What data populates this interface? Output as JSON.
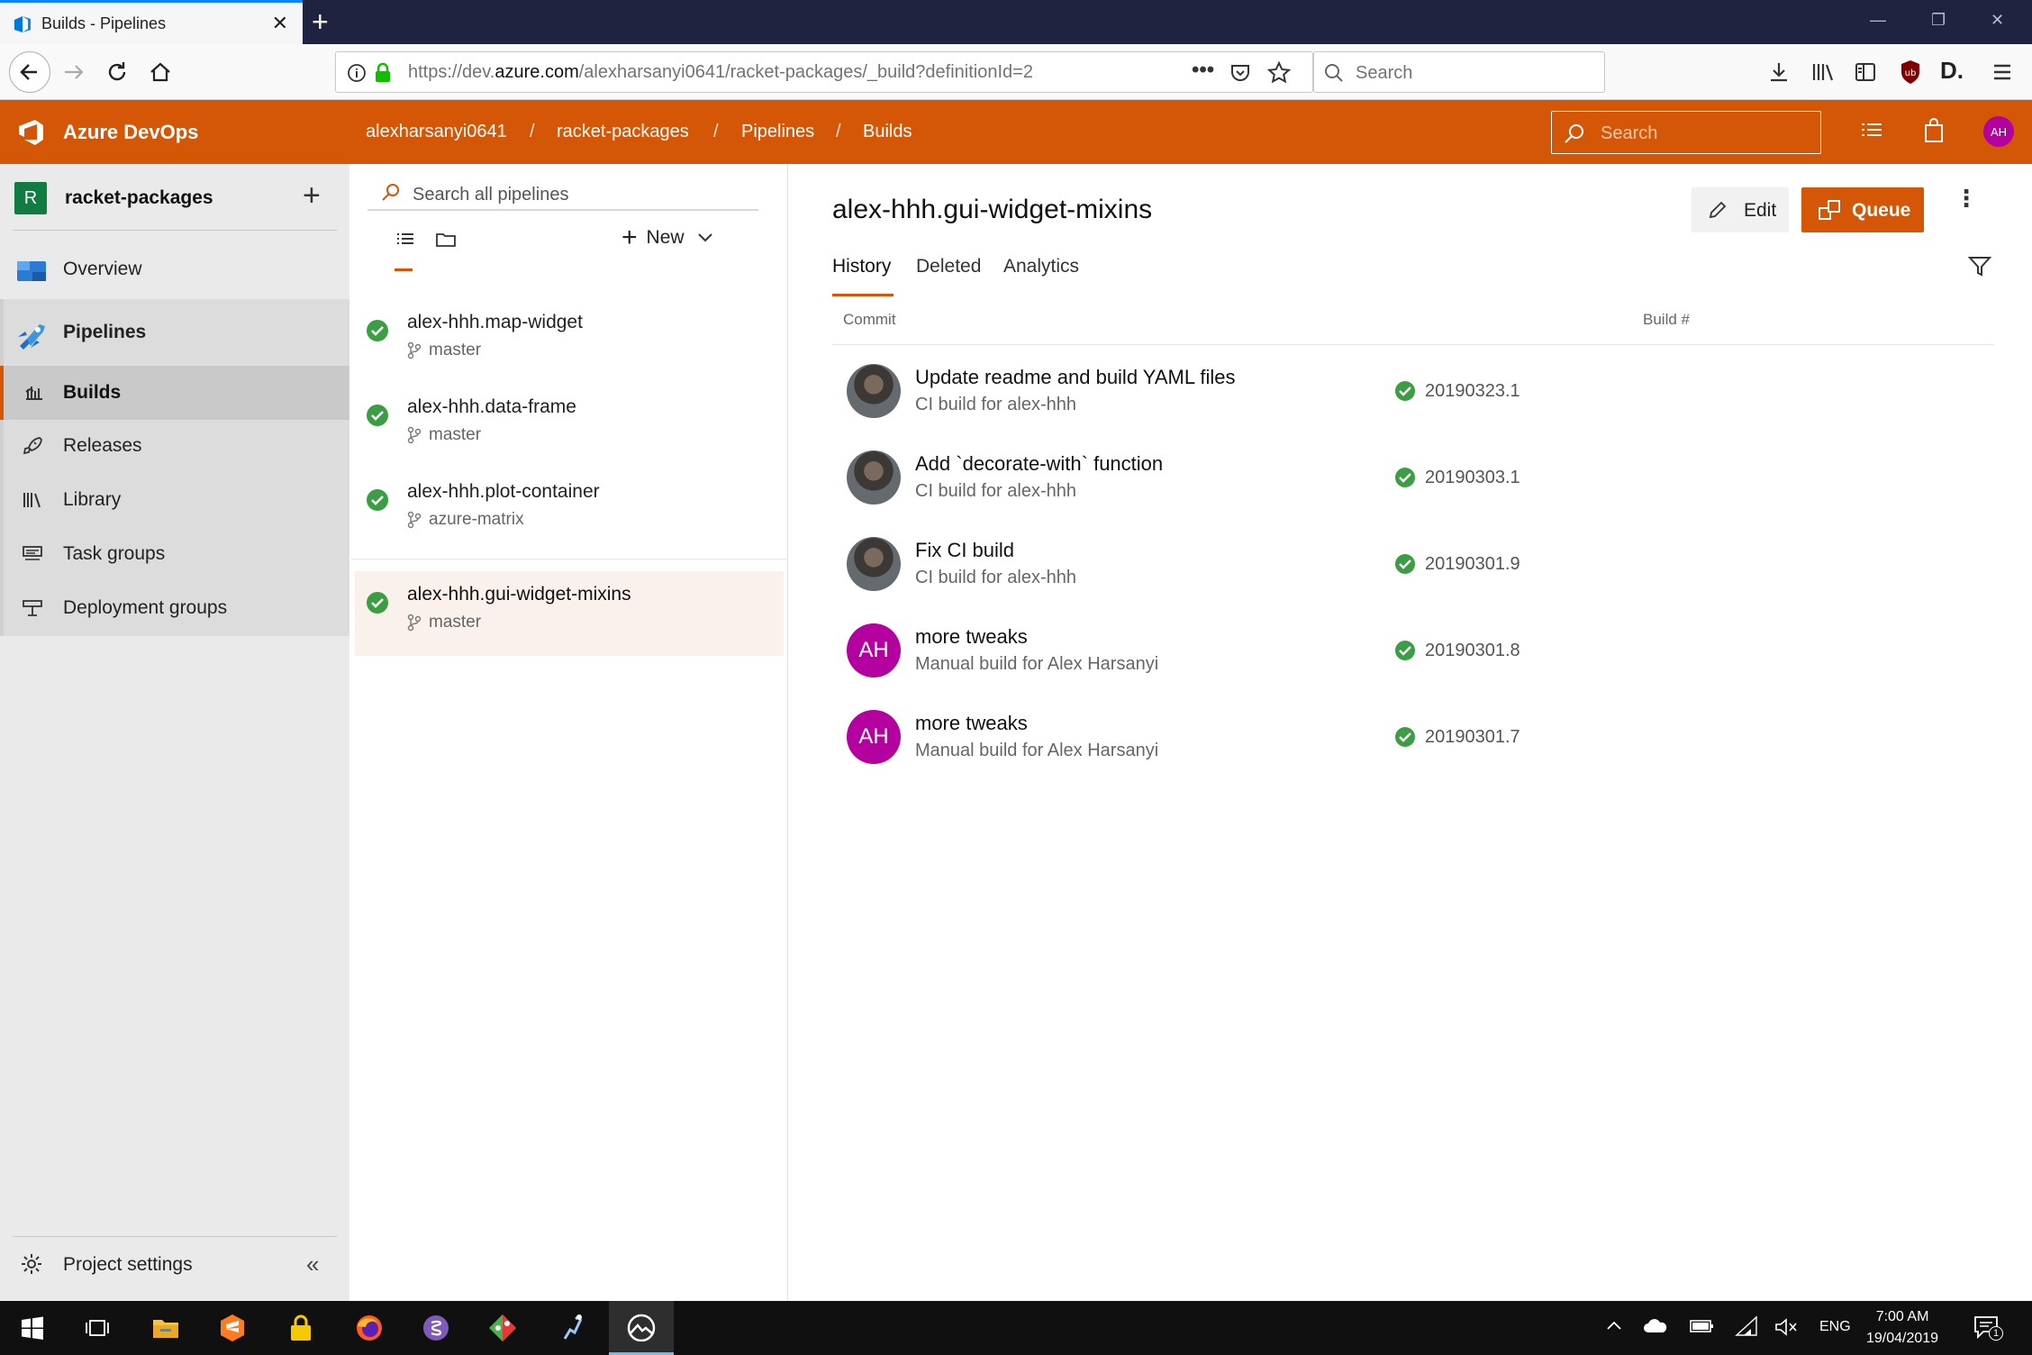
{
  "browser": {
    "tab_title": "Builds - Pipelines",
    "close_tab": "✕",
    "new_tab": "+",
    "url_prefix": "https://dev.",
    "url_domain": "azure.com",
    "url_rest": "/alexharsanyi0641/racket-packages/_build?definitionId=2",
    "search_placeholder": "Search"
  },
  "header": {
    "brand": "Azure DevOps",
    "breadcrumb": [
      "alexharsanyi0641",
      "racket-packages",
      "Pipelines",
      "Builds"
    ],
    "search_placeholder": "Search",
    "user_initials": "AH",
    "accent": "#d45607"
  },
  "sidebar": {
    "project_initial": "R",
    "project_name": "racket-packages",
    "items": [
      {
        "label": "Overview",
        "icon": "overview-icon"
      },
      {
        "label": "Pipelines",
        "icon": "pipelines-icon"
      },
      {
        "label": "Builds",
        "icon": "builds-icon"
      },
      {
        "label": "Releases",
        "icon": "rocket-icon"
      },
      {
        "label": "Library",
        "icon": "library-icon"
      },
      {
        "label": "Task groups",
        "icon": "task-groups-icon"
      },
      {
        "label": "Deployment groups",
        "icon": "deployment-groups-icon"
      }
    ],
    "project_settings": "Project settings"
  },
  "pipelines": {
    "search_placeholder": "Search all pipelines",
    "new_label": "New",
    "items": [
      {
        "name": "alex-hhh.map-widget",
        "branch": "master"
      },
      {
        "name": "alex-hhh.data-frame",
        "branch": "master"
      },
      {
        "name": "alex-hhh.plot-container",
        "branch": "azure-matrix"
      },
      {
        "name": "alex-hhh.gui-widget-mixins",
        "branch": "master"
      }
    ]
  },
  "main": {
    "title": "alex-hhh.gui-widget-mixins",
    "edit_label": "Edit",
    "queue_label": "Queue",
    "tabs": [
      "History",
      "Deleted",
      "Analytics"
    ],
    "columns": {
      "commit": "Commit",
      "build": "Build #"
    },
    "builds": [
      {
        "title": "Update readme and build YAML files",
        "subtitle": "CI build for alex-hhh",
        "number": "20190323.1",
        "avatar": "photo"
      },
      {
        "title": "Add `decorate-with` function",
        "subtitle": "CI build for alex-hhh",
        "number": "20190303.1",
        "avatar": "photo"
      },
      {
        "title": "Fix CI build",
        "subtitle": "CI build for alex-hhh",
        "number": "20190301.9",
        "avatar": "photo"
      },
      {
        "title": "more tweaks",
        "subtitle": "Manual build for Alex Harsanyi",
        "number": "20190301.8",
        "avatar": "AH"
      },
      {
        "title": "more tweaks",
        "subtitle": "Manual build for Alex Harsanyi",
        "number": "20190301.7",
        "avatar": "AH"
      }
    ]
  },
  "taskbar": {
    "language": "ENG",
    "time": "7:00 AM",
    "date": "19/04/2019",
    "notifications": "1"
  }
}
